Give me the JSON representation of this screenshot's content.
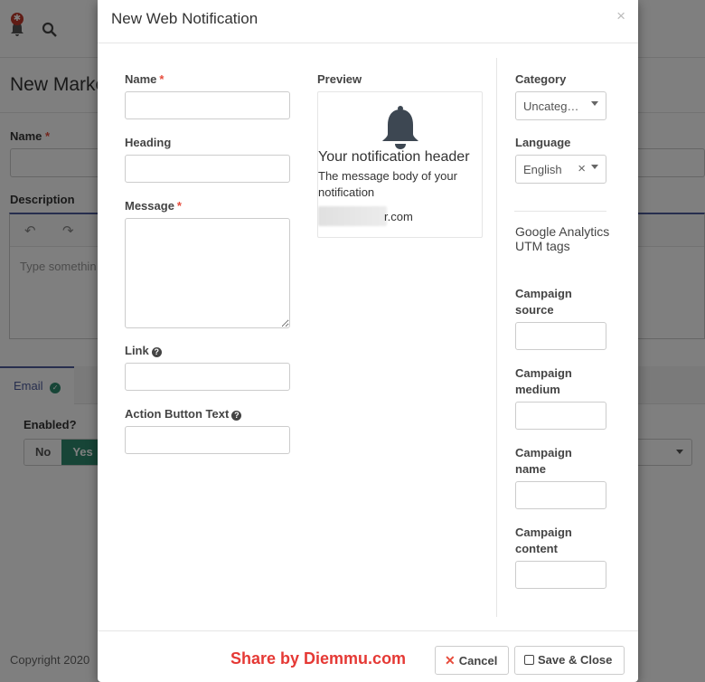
{
  "background": {
    "page_title": "New Marke",
    "name_label": "Name",
    "description_label": "Description",
    "editor_placeholder": "Type somethin",
    "tab_email": "Email",
    "enabled_label": "Enabled?",
    "toggle_no": "No",
    "toggle_yes": "Yes",
    "footer_text": "Copyright 2020"
  },
  "modal": {
    "title": "New Web Notification",
    "close": "×",
    "fields": {
      "name_label": "Name",
      "heading_label": "Heading",
      "message_label": "Message",
      "link_label": "Link",
      "action_button_label": "Action Button Text",
      "required_mark": "*",
      "help_icon": "?"
    },
    "preview": {
      "label": "Preview",
      "header": "Your notification header",
      "body": "The message body of your notification",
      "domain": "r.com"
    },
    "category": {
      "label": "Category",
      "value": "Uncateg…"
    },
    "language": {
      "label": "Language",
      "value": "English",
      "clear": "×"
    },
    "utm": {
      "title": "Google Analytics UTM tags",
      "campaign_source": "Campaign source",
      "campaign_medium": "Campaign medium",
      "campaign_name": "Campaign name",
      "campaign_content": "Campaign content"
    },
    "footer": {
      "watermark": "Share by Diemmu.com",
      "cancel_label": "Cancel",
      "cancel_icon": "✕",
      "save_close_label": "Save & Close"
    }
  },
  "colors": {
    "required": "#e74c3c",
    "accent": "#4e5d9d",
    "toggle_yes": "#2e8b6e",
    "watermark": "#e53935",
    "icon": "#3d4752"
  }
}
